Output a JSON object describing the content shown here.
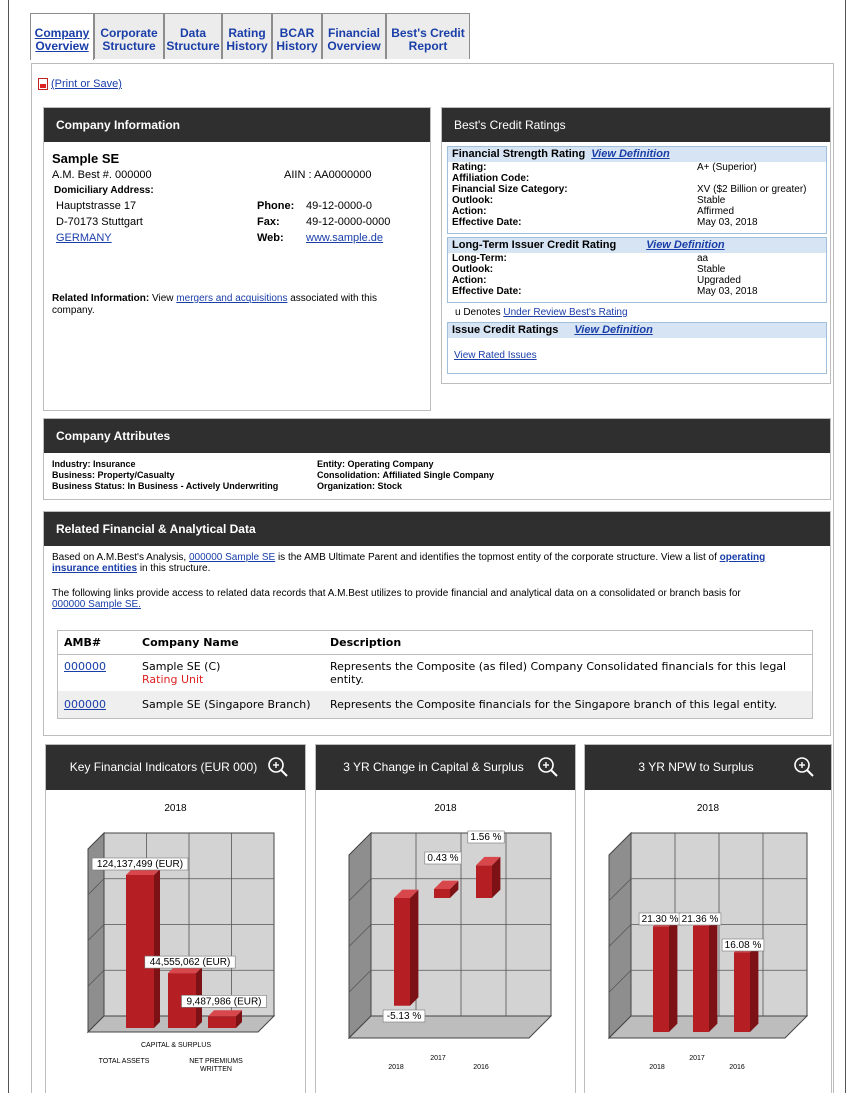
{
  "tabs": [
    {
      "l1": "Company",
      "l2": "Overview",
      "active": true
    },
    {
      "l1": "Corporate",
      "l2": "Structure"
    },
    {
      "l1": "Data",
      "l2": "Structure"
    },
    {
      "l1": "Rating",
      "l2": "History"
    },
    {
      "l1": "BCAR",
      "l2": "History"
    },
    {
      "l1": "Financial",
      "l2": "Overview"
    },
    {
      "l1": "Best's Credit",
      "l2": "Report"
    }
  ],
  "print_link": "(Print or Save)",
  "company_info": {
    "header": "Company Information",
    "name": "Sample SE",
    "amb_line": "A.M. Best #. 000000",
    "aiin": "AIIN : AA0000000",
    "domiciliary_label": "Domiciliary Address:",
    "street": "Hauptstrasse 17",
    "city": "D-70173 Stuttgart",
    "country": "GERMANY",
    "phone_label": "Phone:",
    "phone": "49-12-0000-0",
    "fax_label": "Fax:",
    "fax": "49-12-0000-0000",
    "web_label": "Web:",
    "web": "www.sample.de",
    "related_label": "Related Information:",
    "related_pre": "View",
    "related_link": "mergers and acquisitions",
    "related_post": "associated with this",
    "related_tail": "company."
  },
  "ratings": {
    "header": "Best's Credit Ratings",
    "fsr": {
      "title": "Financial Strength Rating",
      "link": "View Definition",
      "rows": [
        {
          "k": "Rating:",
          "v": "A+ (Superior)"
        },
        {
          "k": "Affiliation Code:",
          "v": ""
        },
        {
          "k": "Financial Size Category:",
          "v": "XV ($2 Billion or greater)"
        },
        {
          "k": "Outlook:",
          "v": "Stable"
        },
        {
          "k": "Action:",
          "v": "Affirmed"
        },
        {
          "k": "Effective Date:",
          "v": "May 03, 2018"
        }
      ]
    },
    "icr": {
      "title": "Long-Term Issuer Credit Rating",
      "link": "View Definition",
      "rows": [
        {
          "k": "Long-Term:",
          "v": "aa"
        },
        {
          "k": "Outlook:",
          "v": "Stable"
        },
        {
          "k": "Action:",
          "v": "Upgraded"
        },
        {
          "k": "Effective Date:",
          "v": "May 03, 2018"
        }
      ]
    },
    "denotes_pre": "u Denotes",
    "denotes_link": "Under Review Best's Rating",
    "issue": {
      "title": "Issue Credit Ratings",
      "link": "View Definition",
      "view_rated": "View Rated Issues"
    }
  },
  "attributes": {
    "header": "Company Attributes",
    "industry_l": "Industry:",
    "industry": "Insurance",
    "business_l": "Business:",
    "business": "Property/Casualty",
    "status_l": "Business Status:",
    "status": "In Business - Actively Underwriting",
    "entity_l": "Entity:",
    "entity": "Operating Company",
    "consol_l": "Consolidation:",
    "consol": "Affiliated Single Company",
    "org_l": "Organization:",
    "org": "Stock"
  },
  "related": {
    "header": "Related Financial & Analytical Data",
    "p1_a": "Based on A.M.Best's Analysis,",
    "p1_link": "000000 Sample SE",
    "p1_b": "is the AMB Ultimate Parent and identifies the topmost entity of the corporate structure. View a list of",
    "p1_link2a": "operating",
    "p1_link2b": "insurance entities",
    "p1_c": "in this structure.",
    "p2": "The following links provide access to related data records that A.M.Best utilizes to provide financial and analytical data on a consolidated or branch basis for",
    "p2_link": "000000 Sample SE.",
    "cols": [
      "AMB#",
      "Company Name",
      "Description"
    ],
    "rows": [
      {
        "amb": "000000",
        "name": "Sample SE (C)",
        "sub": "Rating Unit",
        "desc": "Represents the Composite (as filed) Company Consolidated financials for this legal entity."
      },
      {
        "amb": "000000",
        "name": "Sample SE (Singapore Branch)",
        "sub": "",
        "desc": "Represents the Composite financials for the Singapore branch of this legal entity."
      }
    ]
  },
  "panels": [
    {
      "title": "Key Financial Indicators (EUR 000)",
      "year": "2018"
    },
    {
      "title": "3 YR Change in Capital & Surplus",
      "year": "2018"
    },
    {
      "title": "3 YR NPW to Surplus",
      "year": "2018"
    }
  ],
  "chart_data": [
    {
      "type": "bar",
      "title": "Key Financial Indicators (EUR 000)",
      "subtitle": "2018",
      "categories": [
        "TOTAL ASSETS",
        "CAPITAL & SURPLUS",
        "NET PREMIUMS WRITTEN"
      ],
      "values": [
        124137499,
        44555062,
        9487986
      ],
      "labels": [
        "124,137,499 (EUR)",
        "44,555,062 (EUR)",
        "9,487,986 (EUR)"
      ],
      "bar_color": "#b51f24"
    },
    {
      "type": "bar",
      "title": "3 YR Change in Capital & Surplus",
      "subtitle": "2018",
      "categories": [
        "2018",
        "2017",
        "2016"
      ],
      "values": [
        -5.13,
        0.43,
        1.56
      ],
      "labels": [
        "-5.13 %",
        "0.43 %",
        "1.56 %"
      ],
      "bar_color": "#b51f24"
    },
    {
      "type": "bar",
      "title": "3 YR NPW to Surplus",
      "subtitle": "2018",
      "categories": [
        "2018",
        "2017",
        "2016"
      ],
      "values": [
        21.3,
        21.36,
        16.08
      ],
      "labels": [
        "21.30 %",
        "21.36 %",
        "16.08 %"
      ],
      "bar_color": "#b51f24"
    }
  ]
}
